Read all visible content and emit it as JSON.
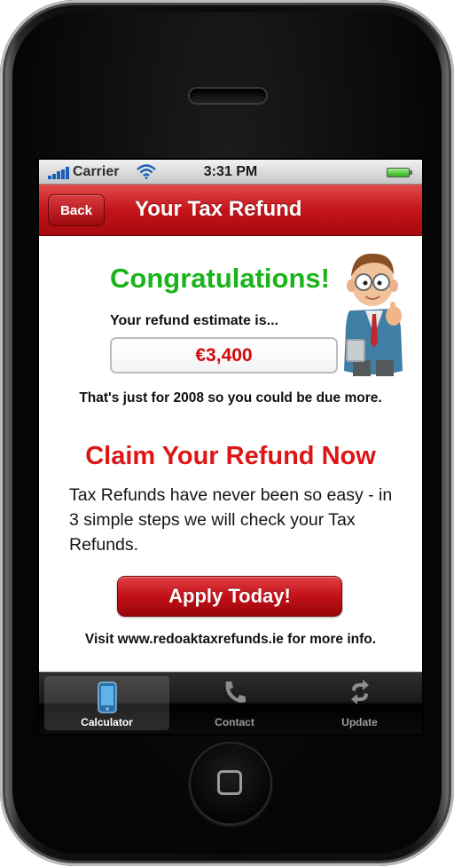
{
  "status_bar": {
    "carrier": "Carrier",
    "time": "3:31 PM"
  },
  "nav": {
    "back_label": "Back",
    "title": "Your Tax Refund"
  },
  "content": {
    "congrats": "Congratulations!",
    "estimate_label": "Your refund estimate is...",
    "refund_value": "€3,400",
    "year_note": "That's just for 2008 so you could be due more.",
    "claim_title": "Claim Your Refund Now",
    "claim_body": "Tax Refunds have never been so easy - in 3 simple steps we will check your Tax Refunds.",
    "apply_label": "Apply Today!",
    "visit_note": "Visit www.redoaktaxrefunds.ie for more info."
  },
  "tabs": [
    {
      "label": "Calculator",
      "icon": "phone-icon",
      "active": true
    },
    {
      "label": "Contact",
      "icon": "handset-icon",
      "active": false
    },
    {
      "label": "Update",
      "icon": "refresh-icon",
      "active": false
    }
  ],
  "colors": {
    "nav_red": "#c4141a",
    "congrats_green": "#19b419",
    "claim_red": "#dc1616",
    "refund_red": "#d20a0a",
    "tab_bar": "#1a1a1a"
  }
}
